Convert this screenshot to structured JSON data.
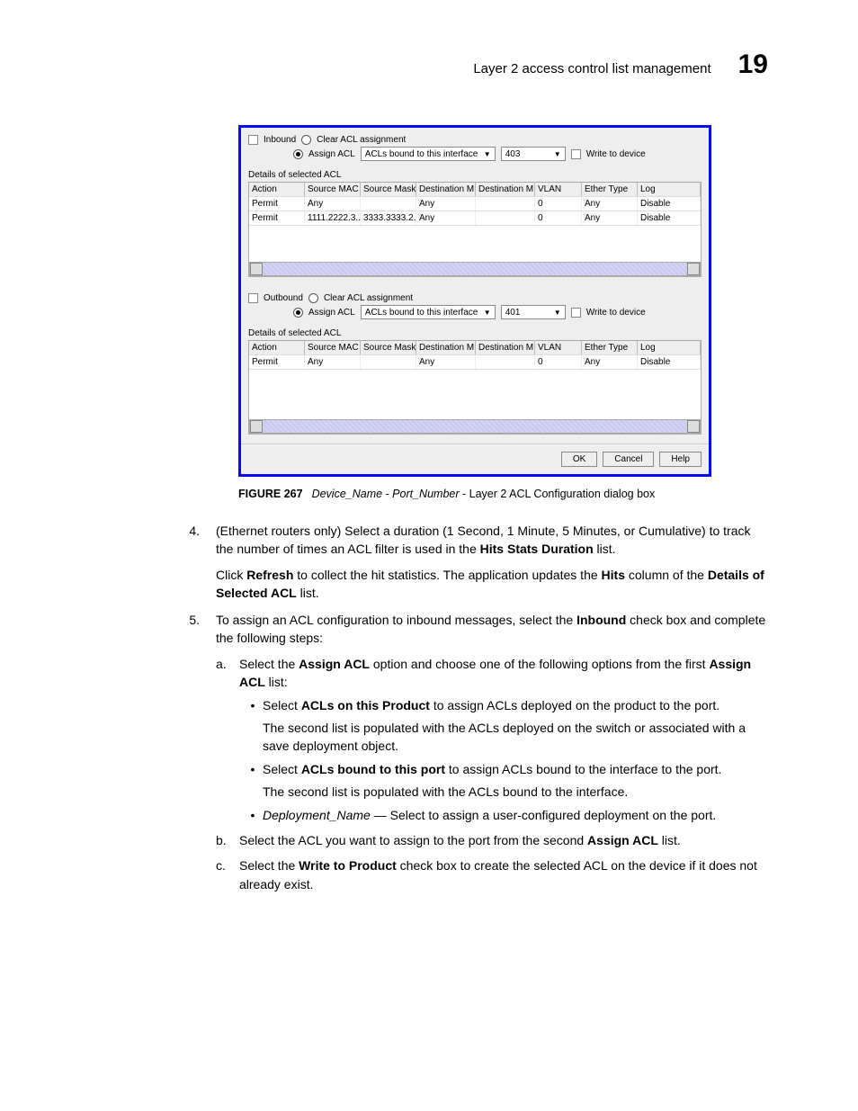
{
  "header": {
    "title": "Layer 2 access control list management",
    "page_num": "19"
  },
  "dialog": {
    "inbound": {
      "chk_label": "Inbound",
      "clear_label": "Clear ACL assignment",
      "assign_label": "Assign ACL",
      "combo1": "ACLs bound to this interface",
      "combo2": "403",
      "write_label": "Write to device",
      "details_label": "Details of selected ACL",
      "cols": [
        "Action",
        "Source MAC",
        "Source Mask",
        "Destination M...",
        "Destination M...",
        "VLAN",
        "Ether Type",
        "Log"
      ],
      "rows": [
        {
          "action": "Permit",
          "smac": "Any",
          "smask": "",
          "dmac": "Any",
          "dmask": "",
          "vlan": "0",
          "etype": "Any",
          "log": "Disable"
        },
        {
          "action": "Permit",
          "smac": "1111.2222.3...",
          "smask": "3333.3333.2...",
          "dmac": "Any",
          "dmask": "",
          "vlan": "0",
          "etype": "Any",
          "log": "Disable"
        }
      ]
    },
    "outbound": {
      "chk_label": "Outbound",
      "clear_label": "Clear ACL assignment",
      "assign_label": "Assign ACL",
      "combo1": "ACLs bound to this interface",
      "combo2": "401",
      "write_label": "Write to device",
      "details_label": "Details of selected ACL",
      "cols": [
        "Action",
        "Source MAC",
        "Source Mask",
        "Destination M...",
        "Destination M...",
        "VLAN",
        "Ether Type",
        "Log"
      ],
      "rows": [
        {
          "action": "Permit",
          "smac": "Any",
          "smask": "",
          "dmac": "Any",
          "dmask": "",
          "vlan": "0",
          "etype": "Any",
          "log": "Disable"
        }
      ]
    },
    "buttons": {
      "ok": "OK",
      "cancel": "Cancel",
      "help": "Help"
    }
  },
  "figure": {
    "label": "FIGURE 267",
    "italic": "Device_Name - Port_Number",
    "rest": " - Layer 2 ACL Configuration dialog box"
  },
  "steps": {
    "s4_num": "4.",
    "s4_a": "(Ethernet routers only) Select a duration (1 Second, 1 Minute, 5 Minutes, or Cumulative) to track the number of times an ACL filter is used in the ",
    "s4_b": "Hits Stats Duration",
    "s4_c": " list.",
    "s4p_a": "Click ",
    "s4p_b": "Refresh",
    "s4p_c": " to collect the hit statistics. The application updates the ",
    "s4p_d": "Hits",
    "s4p_e": " column of the ",
    "s4p_f": "Details of Selected ACL",
    "s4p_g": " list.",
    "s5_num": "5.",
    "s5_a": "To assign an ACL configuration to inbound messages, select the ",
    "s5_b": "Inbound",
    "s5_c": " check box and complete the following steps:",
    "a_letter": "a.",
    "a_1": "Select the ",
    "a_2": "Assign ACL",
    "a_3": " option and choose one of the following options from the first ",
    "a_4": "Assign ACL",
    "a_5": " list:",
    "bul1_a": "Select ",
    "bul1_b": "ACLs on this Product",
    "bul1_c": " to assign ACLs deployed on the product to the port.",
    "bul1_cont": "The second list is populated with the ACLs deployed on the switch or associated with a save deployment object.",
    "bul2_a": "Select ",
    "bul2_b": "ACLs bound to this port",
    "bul2_c": " to assign ACLs bound to the interface to the port.",
    "bul2_cont": "The second list is populated with the ACLs bound to the interface.",
    "bul3_a": "Deployment_Name",
    "bul3_b": " — Select to assign a user-configured deployment on the port.",
    "b_letter": "b.",
    "b_1": "Select the ACL you want to assign to the port from the second ",
    "b_2": "Assign ACL",
    "b_3": " list.",
    "c_letter": "c.",
    "c_1": "Select the ",
    "c_2": "Write to Product",
    "c_3": " check box to create the selected ACL on the device if it does not already exist."
  }
}
